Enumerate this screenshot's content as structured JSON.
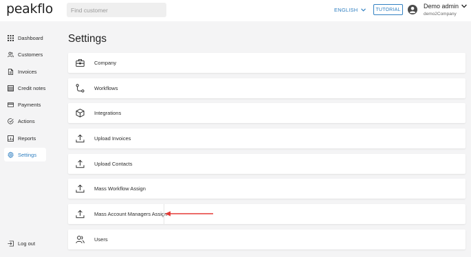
{
  "app": {
    "logo_text": "peakflo"
  },
  "search": {
    "placeholder": "Find customer"
  },
  "header": {
    "language": "ENGLISH",
    "tutorial_label": "TUTORIAL",
    "user_name": "Demo admin",
    "user_company": "demo2Company"
  },
  "sidebar": {
    "items": [
      {
        "label": "Dashboard",
        "icon": "grid-icon"
      },
      {
        "label": "Customers",
        "icon": "users-icon"
      },
      {
        "label": "Invoices",
        "icon": "document-icon"
      },
      {
        "label": "Credit notes",
        "icon": "list-icon"
      },
      {
        "label": "Payments",
        "icon": "credit-card-icon"
      },
      {
        "label": "Actions",
        "icon": "check-circle-icon"
      },
      {
        "label": "Reports",
        "icon": "chart-icon"
      },
      {
        "label": "Settings",
        "icon": "gear-icon",
        "active": true
      }
    ],
    "logout_label": "Log out"
  },
  "main": {
    "title": "Settings",
    "rows": [
      {
        "label": "Company",
        "icon": "briefcase-icon"
      },
      {
        "label": "Workflows",
        "icon": "workflow-icon"
      },
      {
        "label": "Integrations",
        "icon": "cube-icon"
      },
      {
        "label": "Upload Invoices",
        "icon": "upload-icon"
      },
      {
        "label": "Upload Contacts",
        "icon": "upload-icon"
      },
      {
        "label": "Mass Workflow Assign",
        "icon": "upload-icon"
      },
      {
        "label": "Mass Account Managers Assign",
        "icon": "upload-icon",
        "annotated": true
      },
      {
        "label": "Users",
        "icon": "users-icon"
      }
    ]
  },
  "colors": {
    "accent": "#2f7fc1",
    "background": "#f4f4f5",
    "annotation_arrow": "#e53935"
  }
}
